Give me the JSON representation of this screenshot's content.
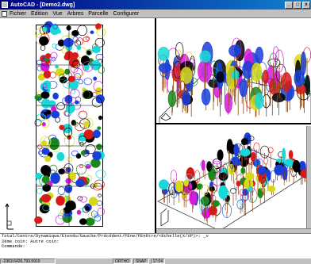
{
  "window": {
    "title": "AutoCAD - [Demo2.dwg]",
    "minimize_glyph": "_",
    "maximize_glyph": "□",
    "close_glyph": "x"
  },
  "menu": {
    "items": [
      "Fichier",
      "Edition",
      "Vue",
      "Arbres",
      "Parcelle",
      "Configurer"
    ]
  },
  "command": {
    "lines": [
      "Total/Centre/Dynamique/Etendu/Gauche/Précédent/FEne/FEnêtre/<Echelle(X/XP)>: _v",
      "2ème coin: Autre coin:",
      "Commande:"
    ]
  },
  "status": {
    "coords": "-2363.6426,793.5919",
    "mode_ortho": "ORTHO",
    "mode_snap": "SNAP",
    "time": "17:04"
  },
  "colors": {
    "titlebar": "#000080",
    "panel_bg": "#c0c0c0",
    "canvas": "#ffffff"
  },
  "icons": [
    "app-icon",
    "document-icon",
    "ucs-icon"
  ]
}
